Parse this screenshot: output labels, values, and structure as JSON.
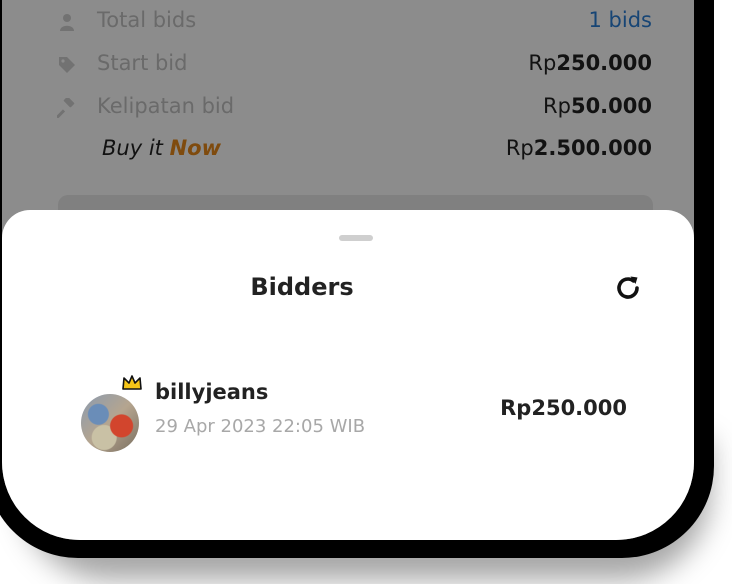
{
  "auction_info": {
    "total_bids": {
      "icon": "user-icon",
      "label": "Total bids",
      "value": "1 bids"
    },
    "start_bid": {
      "icon": "tag-icon",
      "label": "Start bid",
      "currency": "Rp",
      "amount": "250.000"
    },
    "bid_increment": {
      "icon": "hammer-icon",
      "label": "Kelipatan bid",
      "currency": "Rp",
      "amount": "50.000"
    },
    "buy_it_now": {
      "label_prefix": "Buy it ",
      "label_highlight": "Now",
      "currency": "Rp",
      "amount": "2.500.000"
    }
  },
  "sheet": {
    "title": "Bidders",
    "refresh_icon": "refresh-icon",
    "bidders": [
      {
        "name": "billyjeans",
        "time": "29 Apr 2023 22:05 WIB",
        "amount": "Rp250.000",
        "badge": "crown-icon"
      }
    ]
  },
  "colors": {
    "link": "#2a7fd6",
    "highlight": "#e8891b",
    "overlay": "rgba(0,0,0,0.45)"
  }
}
